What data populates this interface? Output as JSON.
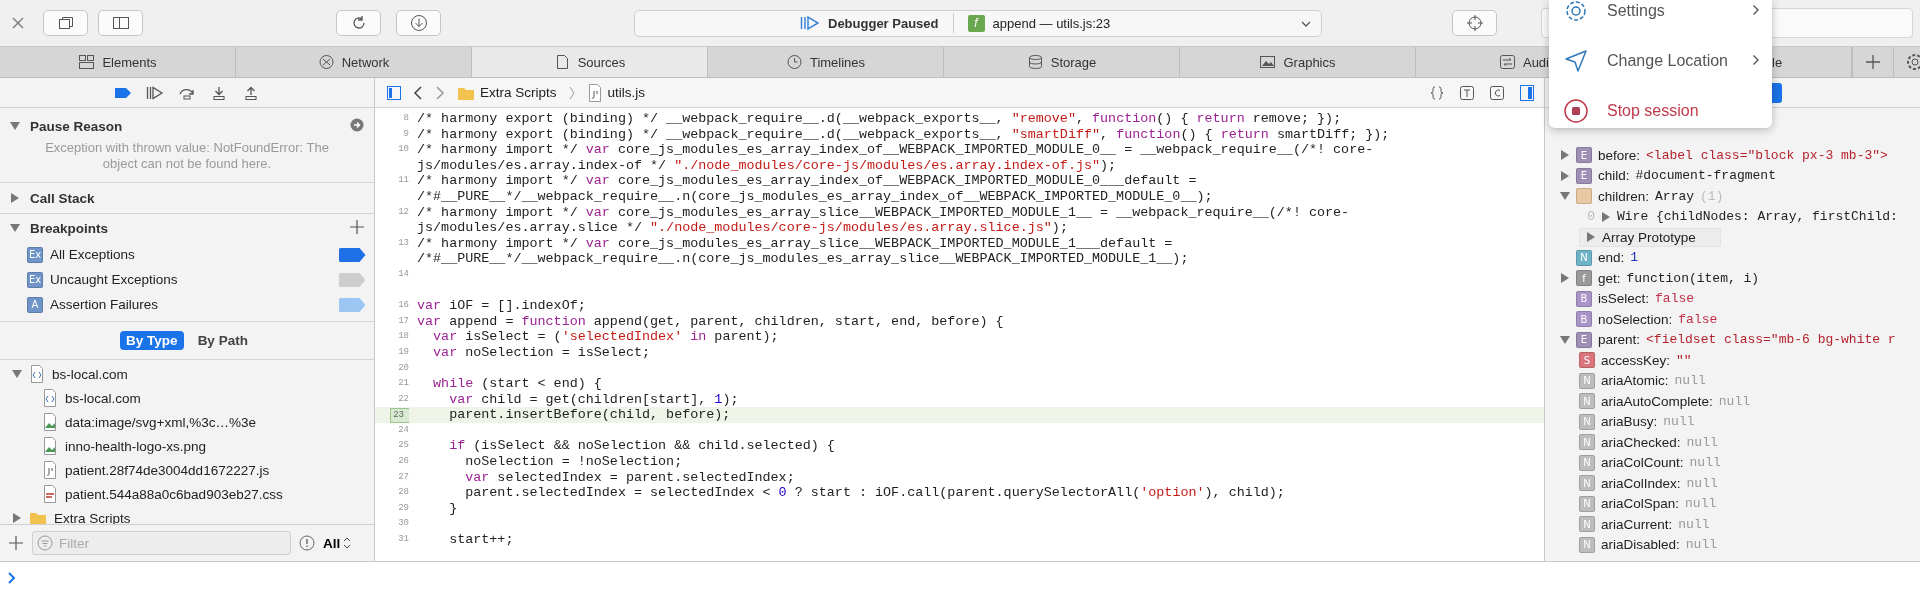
{
  "toolbar": {
    "status": "Debugger Paused",
    "frame_badge": "f",
    "frame": "append — utils.js:23"
  },
  "tabs": [
    {
      "label": "Elements",
      "selected": false
    },
    {
      "label": "Network",
      "selected": false
    },
    {
      "label": "Sources",
      "selected": true
    },
    {
      "label": "Timelines",
      "selected": false
    },
    {
      "label": "Storage",
      "selected": false
    },
    {
      "label": "Graphics",
      "selected": false
    },
    {
      "label": "Audi",
      "selected": false
    },
    {
      "label": "le",
      "selected": false
    }
  ],
  "menu": {
    "items": [
      {
        "label": "Settings",
        "submenu": true,
        "danger": false
      },
      {
        "label": "Change Location",
        "submenu": true,
        "danger": false
      },
      {
        "label": "Stop session",
        "submenu": false,
        "danger": true
      }
    ]
  },
  "sidebar": {
    "pause_reason": {
      "title": "Pause Reason",
      "expanded": true,
      "message": "Exception with thrown value: NotFoundError: The object can not be found here."
    },
    "call_stack": {
      "title": "Call Stack",
      "expanded": false
    },
    "breakpoints": {
      "title": "Breakpoints",
      "expanded": true,
      "items": [
        {
          "badge": "Ex",
          "label": "All Exceptions",
          "color": "#1f6fe6"
        },
        {
          "badge": "Ex",
          "label": "Uncaught Exceptions",
          "color": "#cdcdcd"
        },
        {
          "badge": "A",
          "label": "Assertion Failures",
          "color": "#9cc7f3"
        }
      ]
    },
    "grouping": [
      {
        "label": "By Type",
        "selected": true
      },
      {
        "label": "By Path",
        "selected": false
      }
    ],
    "files": [
      {
        "label": "bs-local.com",
        "kind": "html",
        "expanded": true,
        "children": [
          {
            "label": "bs-local.com",
            "kind": "html"
          },
          {
            "label": "data:image/svg+xml,%3c…%3e",
            "kind": "image"
          },
          {
            "label": "inno-health-logo-xs.png",
            "kind": "image"
          },
          {
            "label": "patient.28f74de3004dd1672227.js",
            "kind": "script"
          },
          {
            "label": "patient.544a88a0c6bad903eb27.css",
            "kind": "stylesheet"
          }
        ]
      },
      {
        "label": "Extra Scripts",
        "kind": "folder",
        "expanded": false
      }
    ],
    "filter": {
      "placeholder": "Filter",
      "scope": "All"
    }
  },
  "editor": {
    "breadcrumbs": [
      "Extra Scripts",
      "utils.js"
    ],
    "lines": [
      {
        "number": "8",
        "current": false,
        "rows": [
          "/* harmony export (binding) */ __webpack_require__.d(__webpack_exports__, \"remove\", function() { return remove; });"
        ]
      },
      {
        "number": "9",
        "current": false,
        "rows": [
          "/* harmony export (binding) */ __webpack_require__.d(__webpack_exports__, \"smartDiff\", function() { return smartDiff; });"
        ]
      },
      {
        "number": "10",
        "current": false,
        "rows": [
          "/* harmony import */ var core_js_modules_es_array_index_of__WEBPACK_IMPORTED_MODULE_0__ = __webpack_require__(/*! core-",
          "js/modules/es.array.index-of */ \"./node_modules/core-js/modules/es.array.index-of.js\");"
        ]
      },
      {
        "number": "11",
        "current": false,
        "rows": [
          "/* harmony import */ var core_js_modules_es_array_index_of__WEBPACK_IMPORTED_MODULE_0___default =",
          "/*#__PURE__*/__webpack_require__.n(core_js_modules_es_array_index_of__WEBPACK_IMPORTED_MODULE_0__);"
        ]
      },
      {
        "number": "12",
        "current": false,
        "rows": [
          "/* harmony import */ var core_js_modules_es_array_slice__WEBPACK_IMPORTED_MODULE_1__ = __webpack_require__(/*! core-",
          "js/modules/es.array.slice */ \"./node_modules/core-js/modules/es.array.slice.js\");"
        ]
      },
      {
        "number": "13",
        "current": false,
        "rows": [
          "/* harmony import */ var core_js_modules_es_array_slice__WEBPACK_IMPORTED_MODULE_1___default =",
          "/*#__PURE__*/__webpack_require__.n(core_js_modules_es_array_slice__WEBPACK_IMPORTED_MODULE_1__);"
        ]
      },
      {
        "number": "14",
        "current": false,
        "rows": [
          ""
        ]
      },
      {
        "current": false,
        "rows": [
          ""
        ]
      },
      {
        "number": "16",
        "current": false,
        "rows": [
          "var iOF = [].indexOf;"
        ]
      },
      {
        "number": "17",
        "current": false,
        "rows": [
          "var append = function append(get, parent, children, start, end, before) {"
        ]
      },
      {
        "number": "18",
        "current": false,
        "rows": [
          "  var isSelect = ('selectedIndex' in parent);"
        ]
      },
      {
        "number": "19",
        "current": false,
        "rows": [
          "  var noSelection = isSelect;"
        ]
      },
      {
        "number": "20",
        "current": false,
        "rows": [
          ""
        ]
      },
      {
        "number": "21",
        "current": false,
        "rows": [
          "  while (start < end) {"
        ]
      },
      {
        "number": "22",
        "current": false,
        "rows": [
          "    var child = get(children[start], 1);"
        ]
      },
      {
        "number": "23",
        "current": true,
        "rows": [
          "    parent.insertBefore(child, before);"
        ]
      },
      {
        "number": "24",
        "current": false,
        "rows": [
          ""
        ]
      },
      {
        "number": "25",
        "current": false,
        "rows": [
          "    if (isSelect && noSelection && child.selected) {"
        ]
      },
      {
        "number": "26",
        "current": false,
        "rows": [
          "      noSelection = !noSelection;"
        ]
      },
      {
        "number": "27",
        "current": false,
        "rows": [
          "      var selectedIndex = parent.selectedIndex;"
        ]
      },
      {
        "number": "28",
        "current": false,
        "rows": [
          "      parent.selectedIndex = selectedIndex < 0 ? start : iOF.call(parent.querySelectorAll('option'), child);"
        ]
      },
      {
        "number": "29",
        "current": false,
        "rows": [
          "    }"
        ]
      },
      {
        "number": "30",
        "current": false,
        "rows": [
          ""
        ]
      },
      {
        "number": "31",
        "current": false,
        "rows": [
          "    start++;"
        ]
      }
    ]
  },
  "scope": {
    "variables": [
      {
        "name": "before:",
        "kind": "element",
        "badge": "E",
        "value": "<label class=\"block px-3 mb-3\">",
        "expanded": false
      },
      {
        "name": "child:",
        "kind": "fragment",
        "badge": "E",
        "value": "#document-fragment",
        "expanded": false
      },
      {
        "name": "children:",
        "kind": "array",
        "value": "Array",
        "count": "(1)",
        "expanded": true,
        "children": [
          {
            "kind": "entry",
            "index": "0",
            "value": "Wire {childNodes: Array, firstChild:",
            "expanded": false
          },
          {
            "kind": "prototype",
            "name": "Array Prototype",
            "expanded": false
          }
        ]
      },
      {
        "name": "end:",
        "kind": "number",
        "badge": "N",
        "value": "1"
      },
      {
        "name": "get:",
        "kind": "function",
        "badge": "f",
        "value": "function(item, i)",
        "expanded": false
      },
      {
        "name": "isSelect:",
        "kind": "boolean",
        "badge": "B",
        "value": "false"
      },
      {
        "name": "noSelection:",
        "kind": "boolean",
        "badge": "B",
        "value": "false"
      },
      {
        "name": "parent:",
        "kind": "element",
        "badge": "E",
        "value": "<fieldset class=\"mb-6 bg-white r",
        "expanded": true,
        "children": [
          {
            "name": "accessKey:",
            "kind": "string",
            "badge": "S",
            "value": "\"\""
          },
          {
            "name": "ariaAtomic:",
            "kind": "null",
            "badge": "N",
            "value": "null"
          },
          {
            "name": "ariaAutoComplete:",
            "kind": "null",
            "badge": "N",
            "value": "null"
          },
          {
            "name": "ariaBusy:",
            "kind": "null",
            "badge": "N",
            "value": "null"
          },
          {
            "name": "ariaChecked:",
            "kind": "null",
            "badge": "N",
            "value": "null"
          },
          {
            "name": "ariaColCount:",
            "kind": "null",
            "badge": "N",
            "value": "null"
          },
          {
            "name": "ariaColIndex:",
            "kind": "null",
            "badge": "N",
            "value": "null"
          },
          {
            "name": "ariaColSpan:",
            "kind": "null",
            "badge": "N",
            "value": "null"
          },
          {
            "name": "ariaCurrent:",
            "kind": "null",
            "badge": "N",
            "value": "null"
          },
          {
            "name": "ariaDisabled:",
            "kind": "null",
            "badge": "N",
            "value": "null"
          }
        ]
      }
    ]
  }
}
